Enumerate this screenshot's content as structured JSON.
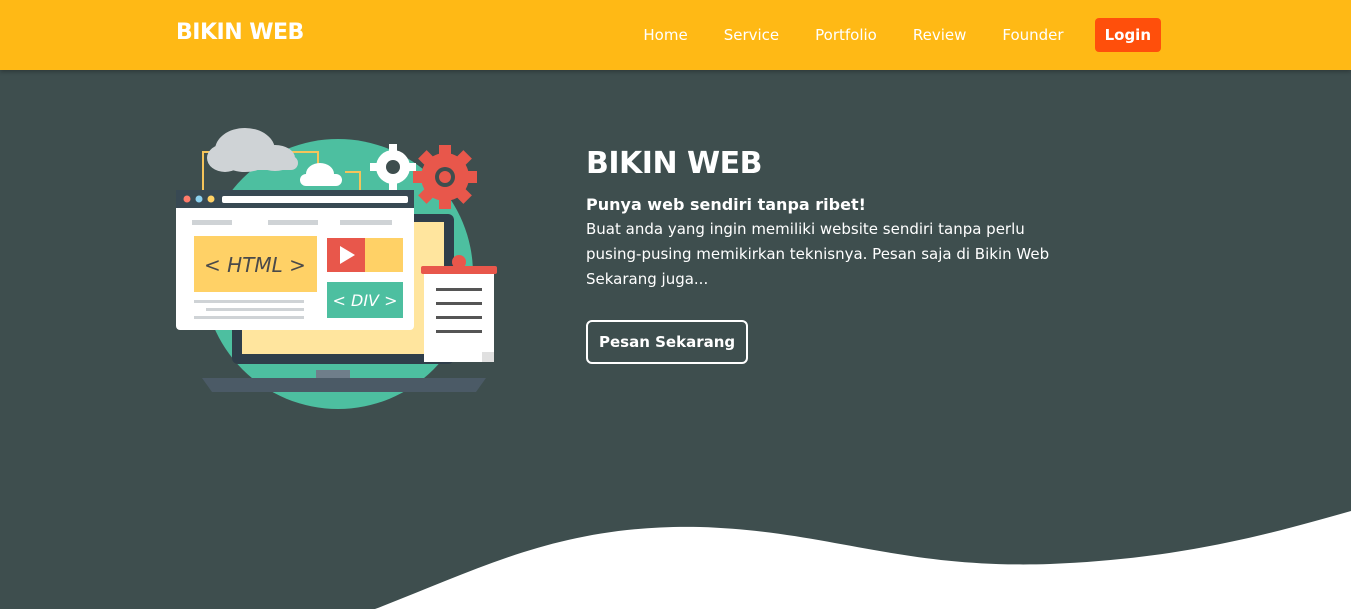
{
  "nav": {
    "brand": "BIKIN WEB",
    "links": [
      "Home",
      "Service",
      "Portfolio",
      "Review",
      "Founder"
    ],
    "login_label": "Login"
  },
  "hero": {
    "title": "BIKIN WEB",
    "subtitle": "Punya web sendiri tanpa ribet!",
    "description": "Buat anda yang ingin memiliki website sendiri tanpa perlu pusing-pusing memikirkan teknisnya. Pesan saja di Bikin Web Sekarang juga...",
    "cta_label": "Pesan Sekarang"
  },
  "illustration": {
    "html_label": "< HTML >",
    "div_label": "< DIV >"
  },
  "colors": {
    "nav_bg": "#ffb915",
    "hero_bg": "#3e4e4e",
    "login_bg": "#ff4f0b",
    "accent_teal": "#4dbfa0",
    "accent_red": "#e8574b"
  },
  "icons": [
    "cloud-icon",
    "gear-icon",
    "browser-window-icon",
    "laptop-icon",
    "document-icon",
    "play-icon"
  ]
}
